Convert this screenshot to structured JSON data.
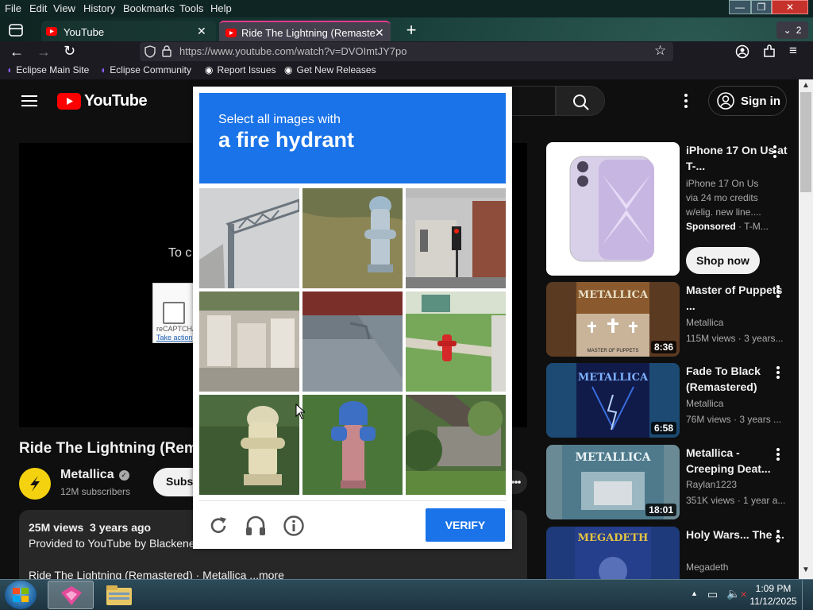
{
  "menubar": {
    "items": [
      "File",
      "Edit",
      "View",
      "History",
      "Bookmarks",
      "Tools",
      "Help"
    ]
  },
  "tabs": [
    {
      "label": "YouTube"
    },
    {
      "label": "Ride The Lightning (Remastered"
    }
  ],
  "tab_count": "2",
  "url": "https://www.youtube.com/watch?v=DVOImtJY7po",
  "bookmarks": [
    "Eclipse Main Site",
    "Eclipse Community",
    "Report Issues",
    "Get New Releases"
  ],
  "youtube": {
    "logo_text": "YouTube",
    "sign_in": "Sign in",
    "player_overlay_text": "To c",
    "recaptcha_label": "reCAPTCHA",
    "recaptcha_action": "Take action",
    "video_title": "Ride The Lightning (Rem",
    "channel_name": "Metallica",
    "subscribers": "12M subscribers",
    "subscribe_label": "Subs",
    "views": "25M views",
    "age": "3 years ago",
    "description_line1": "Provided to YouTube by Blackene",
    "description_line2": "Ride The Lightning (Remastered) · Metallica ...more",
    "sidebar": [
      {
        "title": "iPhone 17 On Us at T-...",
        "line1": "iPhone 17 On Us",
        "line2": "via 24 mo credits",
        "line3": "w/elig. new line....",
        "sponsor": "Sponsored",
        "sponsor_suffix": "· T-M...",
        "cta": "Shop now"
      },
      {
        "title": "Master of Puppets ...",
        "channel": "Metallica",
        "meta": "115M views · 3 years...",
        "duration": "8:36",
        "album_text": "MASTER OF PUPPETS"
      },
      {
        "title": "Fade To Black (Remastered)",
        "channel": "Metallica",
        "meta": "76M views · 3 years ...",
        "duration": "6:58"
      },
      {
        "title": "Metallica - Creeping Deat...",
        "channel": "Raylan1223",
        "meta": "351K views · 1 year a...",
        "duration": "18:01"
      },
      {
        "title": "Holy Wars... The ...",
        "channel": "Megadeth"
      }
    ]
  },
  "captcha": {
    "prompt_small": "Select all images with",
    "prompt_big": "a fire hydrant",
    "verify_label": "VERIFY"
  },
  "taskbar": {
    "time": "1:09 PM",
    "date": "11/12/2025"
  },
  "colors": {
    "accent": "#1a73e8",
    "youtube_red": "#ff0000",
    "page_bg": "#0f0f0f"
  }
}
